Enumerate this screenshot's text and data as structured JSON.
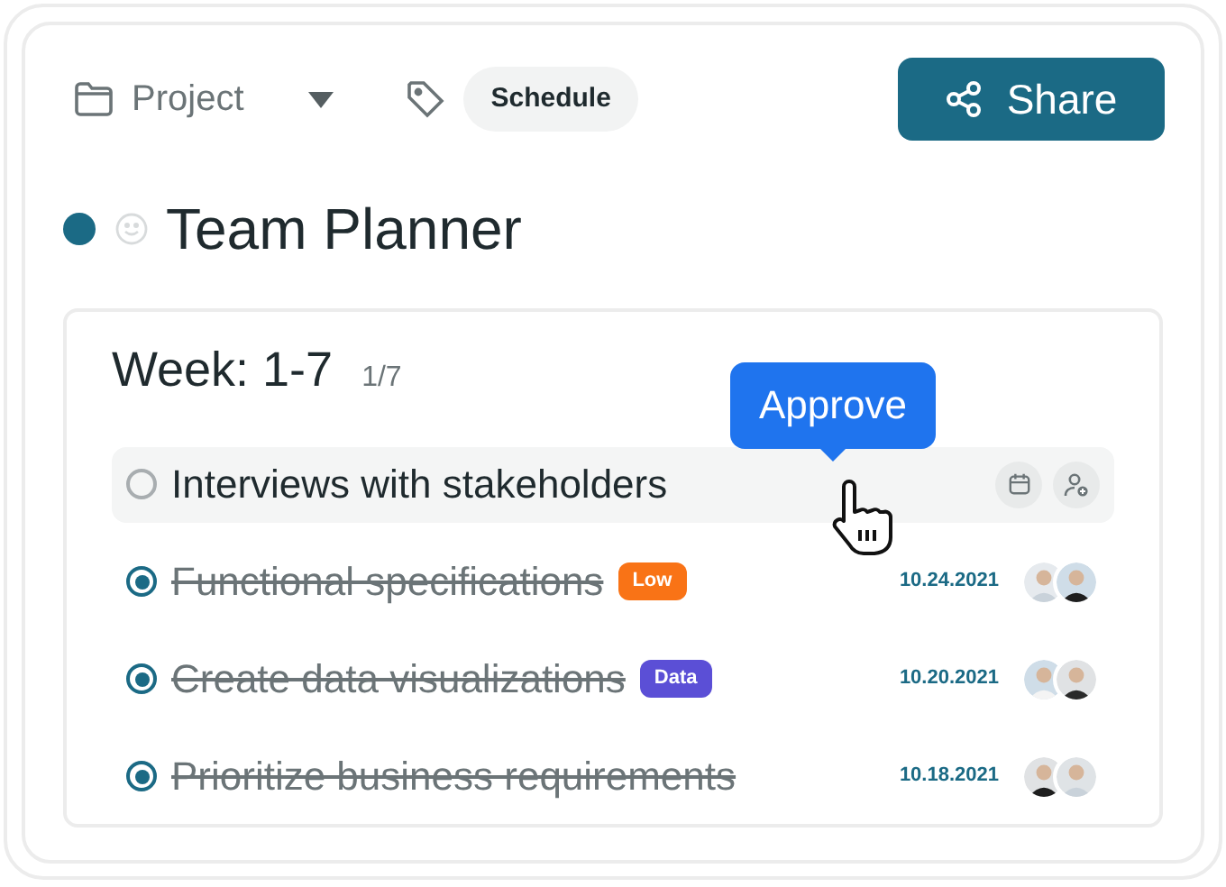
{
  "header": {
    "project": "Project",
    "tag": "Schedule",
    "share_button": "Share"
  },
  "title": "Team Planner",
  "week": {
    "title": "Week: 1-7",
    "count": "1/7"
  },
  "tasks": [
    {
      "label": "Interviews with stakeholders",
      "done": false,
      "selected": true,
      "tooltip": "Approve"
    },
    {
      "label": "Functional specifications",
      "done": true,
      "selected": false,
      "tag": {
        "label": "Low",
        "color": "#f97316"
      },
      "date": "10.24.2021"
    },
    {
      "label": "Create data visualizations",
      "done": true,
      "selected": false,
      "tag": {
        "label": "Data",
        "color": "#5b4fd6"
      },
      "date": "10.20.2021"
    },
    {
      "label": "Prioritize business requirements",
      "done": true,
      "selected": false,
      "date": "10.18.2021"
    }
  ]
}
